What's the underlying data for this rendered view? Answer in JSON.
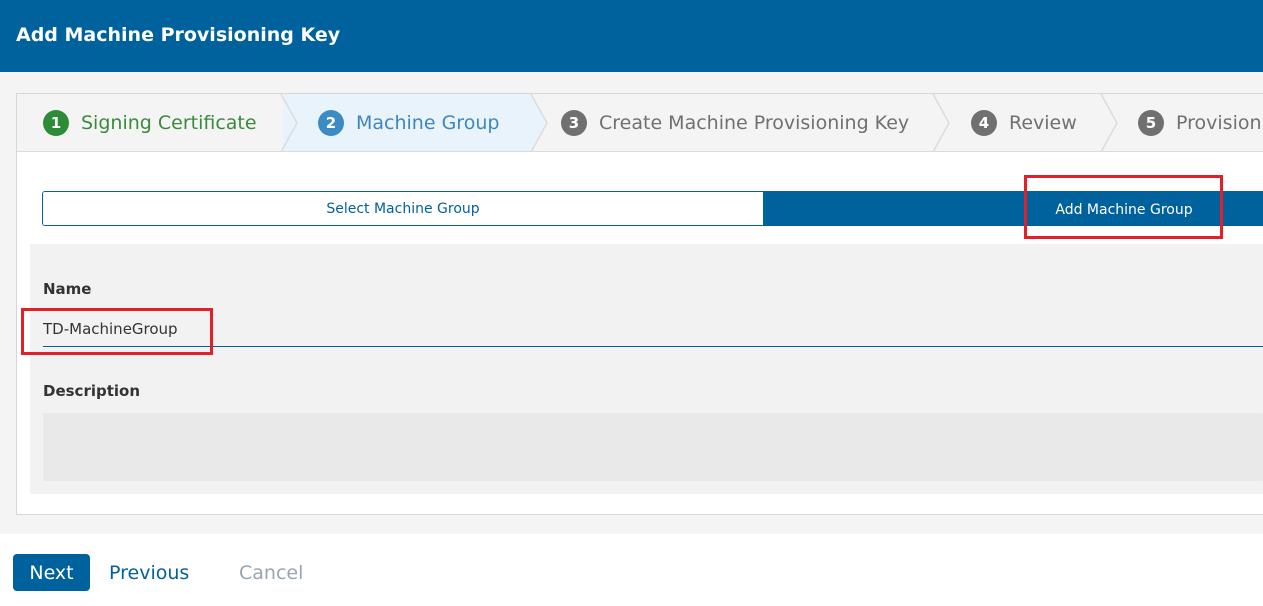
{
  "header": {
    "title": "Add Machine Provisioning Key"
  },
  "steps": [
    {
      "number": "1",
      "label": "Signing Certificate",
      "state": "done"
    },
    {
      "number": "2",
      "label": "Machine Group",
      "state": "active"
    },
    {
      "number": "3",
      "label": "Create Machine Provisioning Key",
      "state": "todo"
    },
    {
      "number": "4",
      "label": "Review",
      "state": "todo"
    },
    {
      "number": "5",
      "label": "Provisioni",
      "state": "todo"
    }
  ],
  "toggle": {
    "select_label": "Select Machine Group",
    "add_label": "Add Machine Group",
    "selected": "Add Machine Group"
  },
  "form": {
    "name_label": "Name",
    "name_value": "TD-MachineGroup",
    "description_label": "Description",
    "description_value": ""
  },
  "footer": {
    "next_label": "Next",
    "previous_label": "Previous",
    "cancel_label": "Cancel"
  },
  "colors": {
    "primary": "#00629d",
    "step_done": "#2e8c36",
    "step_active": "#3b8cc4",
    "highlight": "#e3202a"
  }
}
